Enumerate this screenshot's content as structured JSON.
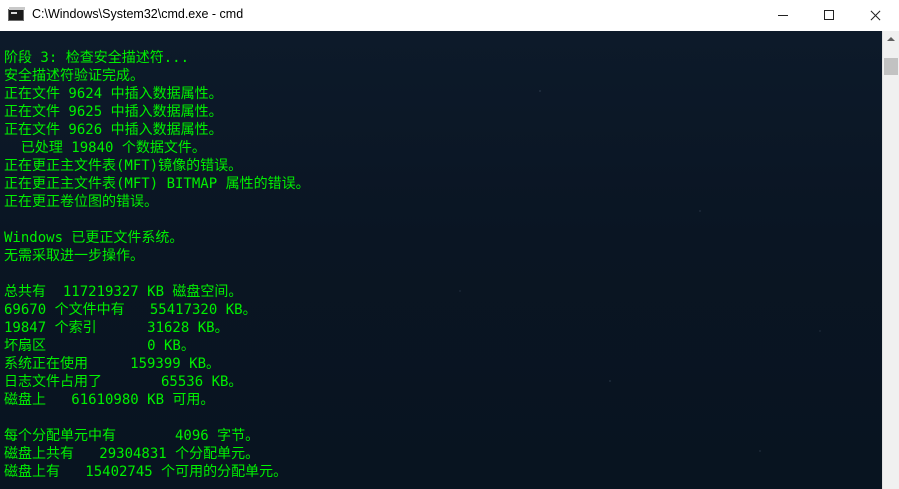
{
  "window": {
    "title": "C:\\Windows\\System32\\cmd.exe - cmd",
    "app_icon": "console-icon"
  },
  "controls": {
    "minimize_icon": "minimize-icon",
    "maximize_icon": "maximize-icon",
    "close_icon": "close-icon"
  },
  "colors": {
    "console_text": "#00f000",
    "console_background": "#0a1523"
  },
  "console": {
    "lines": [
      "阶段 3: 检查安全描述符...",
      "安全描述符验证完成。",
      "正在文件 9624 中插入数据属性。",
      "正在文件 9625 中插入数据属性。",
      "正在文件 9626 中插入数据属性。",
      "  已处理 19840 个数据文件。",
      "正在更正主文件表(MFT)镜像的错误。",
      "正在更正主文件表(MFT) BITMAP 属性的错误。",
      "正在更正卷位图的错误。",
      "",
      "Windows 已更正文件系统。",
      "无需采取进一步操作。",
      "",
      "总共有  117219327 KB 磁盘空间。",
      "69670 个文件中有   55417320 KB。",
      "19847 个索引      31628 KB。",
      "坏扇区            0 KB。",
      "系统正在使用     159399 KB。",
      "日志文件占用了       65536 KB。",
      "磁盘上   61610980 KB 可用。",
      "",
      "每个分配单元中有       4096 字节。",
      "磁盘上共有   29304831 个分配单元。",
      "磁盘上有   15402745 个可用的分配单元。"
    ]
  },
  "scrollbar": {
    "up_icon": "scroll-up-arrow-icon"
  }
}
